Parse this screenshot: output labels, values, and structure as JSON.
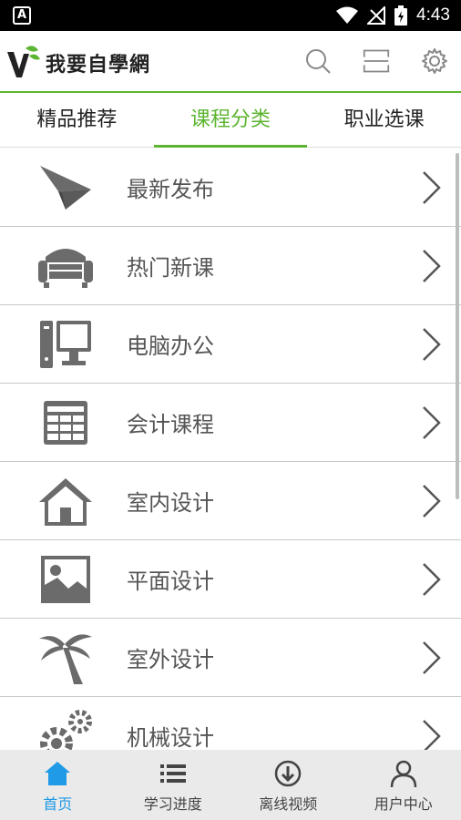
{
  "status_bar": {
    "time": "4:43",
    "left_icon": "A"
  },
  "header": {
    "logo_text": "我要自學網",
    "icons": [
      "search-icon",
      "scan-icon",
      "settings-icon"
    ]
  },
  "tabs": [
    {
      "label": "精品推荐",
      "active": false
    },
    {
      "label": "课程分类",
      "active": true
    },
    {
      "label": "职业选课",
      "active": false
    }
  ],
  "categories": [
    {
      "label": "最新发布",
      "icon": "paper-plane-icon"
    },
    {
      "label": "热门新课",
      "icon": "sofa-icon"
    },
    {
      "label": "电脑办公",
      "icon": "computer-icon"
    },
    {
      "label": "会计课程",
      "icon": "table-icon"
    },
    {
      "label": "室内设计",
      "icon": "house-icon"
    },
    {
      "label": "平面设计",
      "icon": "image-icon"
    },
    {
      "label": "室外设计",
      "icon": "palm-tree-icon"
    },
    {
      "label": "机械设计",
      "icon": "gears-icon"
    }
  ],
  "bottom_nav": [
    {
      "label": "首页",
      "icon": "home-icon",
      "active": true
    },
    {
      "label": "学习进度",
      "icon": "list-icon",
      "active": false
    },
    {
      "label": "离线视频",
      "icon": "download-icon",
      "active": false
    },
    {
      "label": "用户中心",
      "icon": "user-icon",
      "active": false
    }
  ],
  "colors": {
    "accent": "#5cb531",
    "nav_active": "#1e9ae6",
    "icon_gray": "#6b6b6b"
  }
}
